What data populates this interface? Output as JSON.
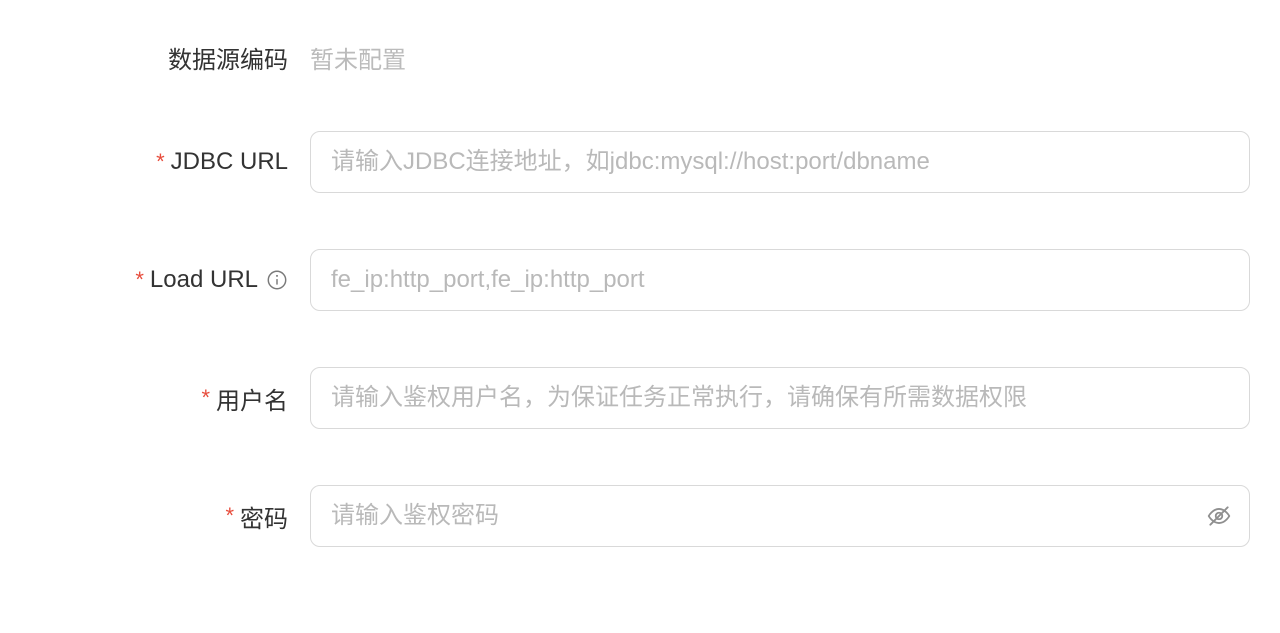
{
  "fields": {
    "datasource_code": {
      "label": "数据源编码",
      "value": "暂未配置"
    },
    "jdbc_url": {
      "label": "JDBC URL",
      "placeholder": "请输入JDBC连接地址，如jdbc:mysql://host:port/dbname",
      "value": ""
    },
    "load_url": {
      "label": "Load URL",
      "placeholder": "fe_ip:http_port,fe_ip:http_port",
      "value": ""
    },
    "username": {
      "label": "用户名",
      "placeholder": "请输入鉴权用户名，为保证任务正常执行，请确保有所需数据权限",
      "value": ""
    },
    "password": {
      "label": "密码",
      "placeholder": "请输入鉴权密码",
      "value": ""
    }
  }
}
